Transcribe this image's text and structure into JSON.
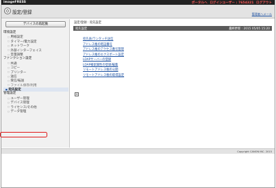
{
  "topbar": {
    "brand": "imageFRESS",
    "nav_portal": "ポータルへ",
    "nav_user": "ログインユーザー : 7654321",
    "nav_logout": "ログアウト"
  },
  "header": {
    "title": "設定/登録",
    "admin_mail": "管理者へメール"
  },
  "sidebar": {
    "restart_label": "デバイスの再起動",
    "preferences": {
      "label": "環境設定",
      "items": [
        "用紙設定",
        "タイマー/電力設定",
        "ネットワーク",
        "外部インターフェイス",
        "音量調整"
      ]
    },
    "function": {
      "label": "ファンクション設定",
      "items": [
        "共通",
        "コピー",
        "プリンター",
        "送信",
        "受信/転送",
        "ファイル保存/利用"
      ]
    },
    "security": {
      "label": "宛先設定"
    },
    "management": {
      "label": "管理設定",
      "items": [
        "ユーザー管理",
        "デバイス管理",
        "ライセンス/その他",
        "データ管理"
      ]
    }
  },
  "main": {
    "breadcrumb": "設定/登録 : 宛先設定",
    "panel_title": "宛先設定",
    "panel_updated": "最終更新 : 2015 05/05 15:20",
    "links": [
      "宛先表/ワンタッチ送信",
      "アドレス帳の暗証番号",
      "アドレス帳のアクセス番号管理",
      "アドレス帳のエクスポート設定",
      "LDAPサーバーの登録",
      "LDAP検索属性の登録/編集",
      "リモートアドレス帳の公開",
      "リモートアドレス帳の取得設定"
    ],
    "collapse_label": "≡"
  },
  "footer": {
    "copyright": "Copyright CANON INC. 2015"
  }
}
